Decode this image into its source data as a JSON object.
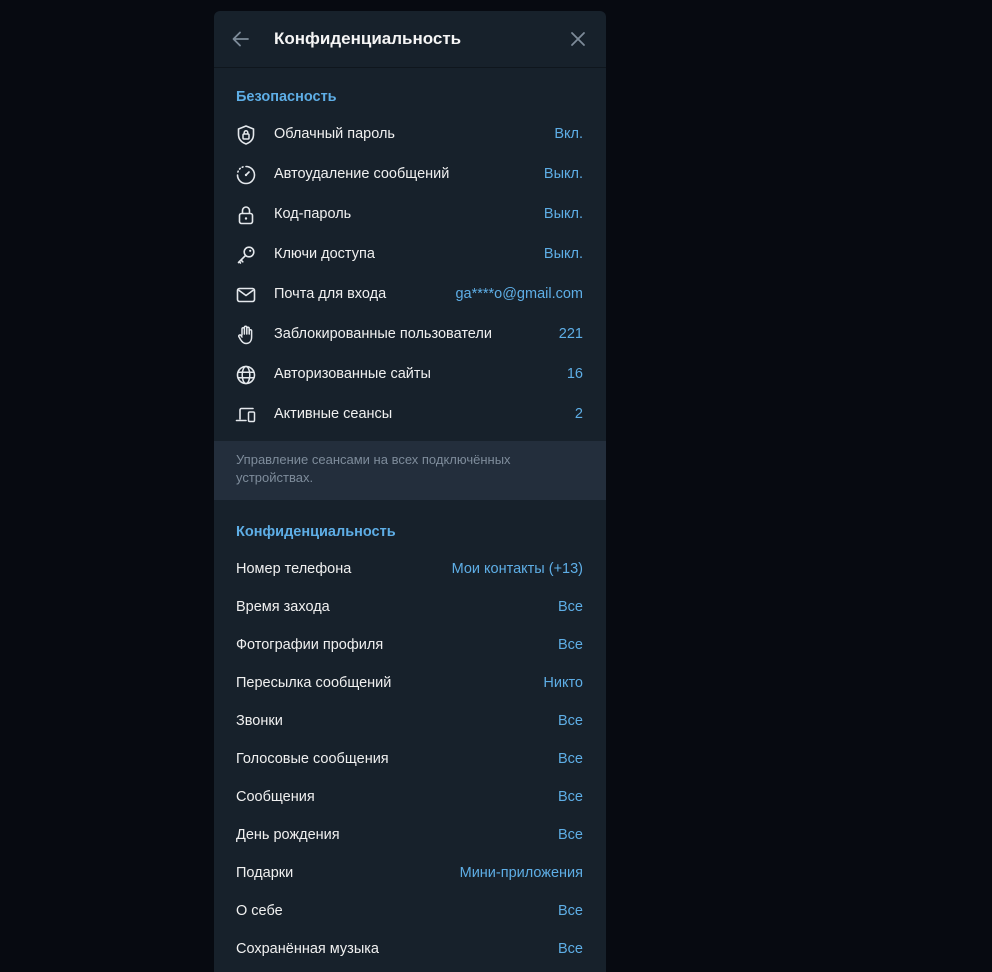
{
  "header": {
    "title": "Конфиденциальность"
  },
  "security": {
    "title": "Безопасность",
    "items": [
      {
        "label": "Облачный пароль",
        "value": "Вкл.",
        "icon": "shield-lock-icon"
      },
      {
        "label": "Автоудаление сообщений",
        "value": "Выкл.",
        "icon": "timer-icon"
      },
      {
        "label": "Код-пароль",
        "value": "Выкл.",
        "icon": "lock-icon"
      },
      {
        "label": "Ключи доступа",
        "value": "Выкл.",
        "icon": "key-icon"
      },
      {
        "label": "Почта для входа",
        "value": "ga****o@gmail.com",
        "icon": "mail-icon"
      },
      {
        "label": "Заблокированные пользователи",
        "value": "221",
        "icon": "hand-icon"
      },
      {
        "label": "Авторизованные сайты",
        "value": "16",
        "icon": "globe-icon"
      },
      {
        "label": "Активные сеансы",
        "value": "2",
        "icon": "devices-icon"
      }
    ],
    "note": "Управление сеансами на всех подключённых устройствах."
  },
  "privacy": {
    "title": "Конфиденциальность",
    "items": [
      {
        "label": "Номер телефона",
        "value": "Мои контакты (+13)"
      },
      {
        "label": "Время захода",
        "value": "Все"
      },
      {
        "label": "Фотографии профиля",
        "value": "Все"
      },
      {
        "label": "Пересылка сообщений",
        "value": "Никто"
      },
      {
        "label": "Звонки",
        "value": "Все"
      },
      {
        "label": "Голосовые сообщения",
        "value": "Все"
      },
      {
        "label": "Сообщения",
        "value": "Все"
      },
      {
        "label": "День рождения",
        "value": "Все"
      },
      {
        "label": "Подарки",
        "value": "Мини-приложения"
      },
      {
        "label": "О себе",
        "value": "Все"
      },
      {
        "label": "Сохранённая музыка",
        "value": "Все"
      }
    ]
  },
  "colors": {
    "background": "#070a11",
    "panel": "#17212b",
    "accent": "#5eaee6",
    "note_background": "#232e3c",
    "note_text": "#7e8c9b"
  }
}
